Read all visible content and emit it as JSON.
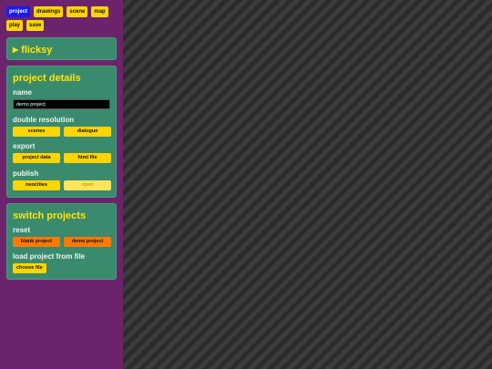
{
  "nav": {
    "row1": [
      "project",
      "drawings",
      "scene",
      "map"
    ],
    "row2": [
      "play",
      "save"
    ],
    "active": "project"
  },
  "flicksy_panel": {
    "arrow": "▶",
    "title": "flicksy"
  },
  "project_details": {
    "title": "project details",
    "name_label": "name",
    "name_value": "demo project",
    "double_res_label": "double resolution",
    "double_res_buttons": [
      "scenes",
      "dialogue"
    ],
    "export_label": "export",
    "export_buttons": [
      "project data",
      "html file"
    ],
    "publish_label": "publish",
    "publish_buttons": [
      "neocities",
      "open"
    ]
  },
  "switch_projects": {
    "title": "switch projects",
    "reset_label": "reset",
    "reset_buttons": [
      "blank project",
      "demo project"
    ],
    "load_label": "load project from file",
    "choose_file_label": "choose file"
  },
  "colors": {
    "sidebar": "#6b246b",
    "panel": "#3a8a6e",
    "accent_yellow": "#ffd500",
    "accent_orange": "#ff7800",
    "active_blue": "#1a1af5",
    "header_text": "#ffe600"
  }
}
